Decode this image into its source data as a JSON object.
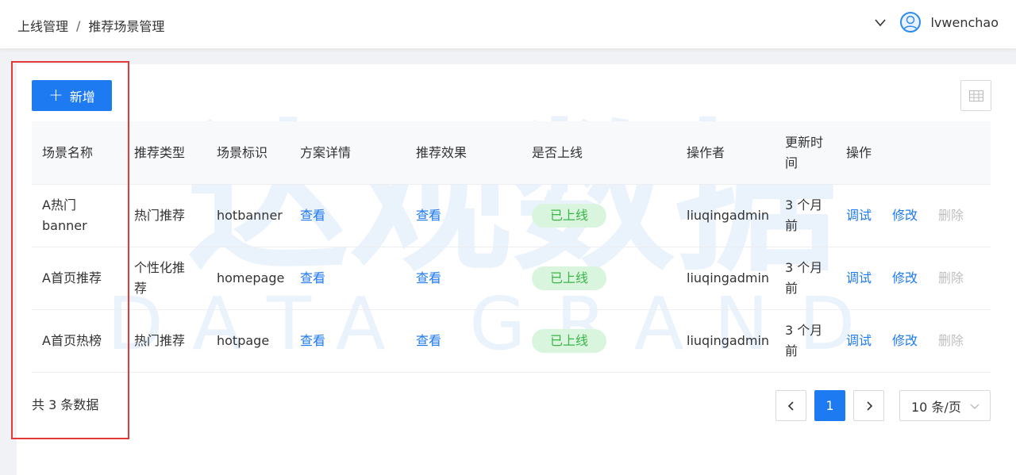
{
  "breadcrumb": {
    "root": "上线管理",
    "separator": "/",
    "current": "推荐场景管理"
  },
  "user": {
    "name": "lvwenchao"
  },
  "toolbar": {
    "add_label": "新增"
  },
  "columns": [
    "场景名称",
    "推荐类型",
    "场景标识",
    "方案详情",
    "推荐效果",
    "是否上线",
    "操作者",
    "更新时间",
    "操作"
  ],
  "rows": [
    {
      "name": "A热门banner",
      "type": "热门推荐",
      "key": "hotbanner",
      "detail": "查看",
      "effect": "查看",
      "status": "已上线",
      "operator": "liuqingadmin",
      "updated": "3 个月前",
      "actions": [
        "调试",
        "修改",
        "删除"
      ]
    },
    {
      "name": "A首页推荐",
      "type": "个性化推荐",
      "key": "homepage",
      "detail": "查看",
      "effect": "查看",
      "status": "已上线",
      "operator": "liuqingadmin",
      "updated": "3 个月前",
      "actions": [
        "调试",
        "修改",
        "删除"
      ]
    },
    {
      "name": "A首页热榜",
      "type": "热门推荐",
      "key": "hotpage",
      "detail": "查看",
      "effect": "查看",
      "status": "已上线",
      "operator": "liuqingadmin",
      "updated": "3 个月前",
      "actions": [
        "调试",
        "修改",
        "删除"
      ]
    }
  ],
  "pagination": {
    "total_text": "共 3 条数据",
    "current_page": "1",
    "page_size": "10 条/页"
  },
  "watermark": {
    "cn": "达观数据",
    "en": "DATA GRAND"
  },
  "colors": {
    "primary": "#1e7af0",
    "success_bg": "#d9f5dd",
    "success_text": "#3bb54a",
    "highlight": "#e53935"
  }
}
